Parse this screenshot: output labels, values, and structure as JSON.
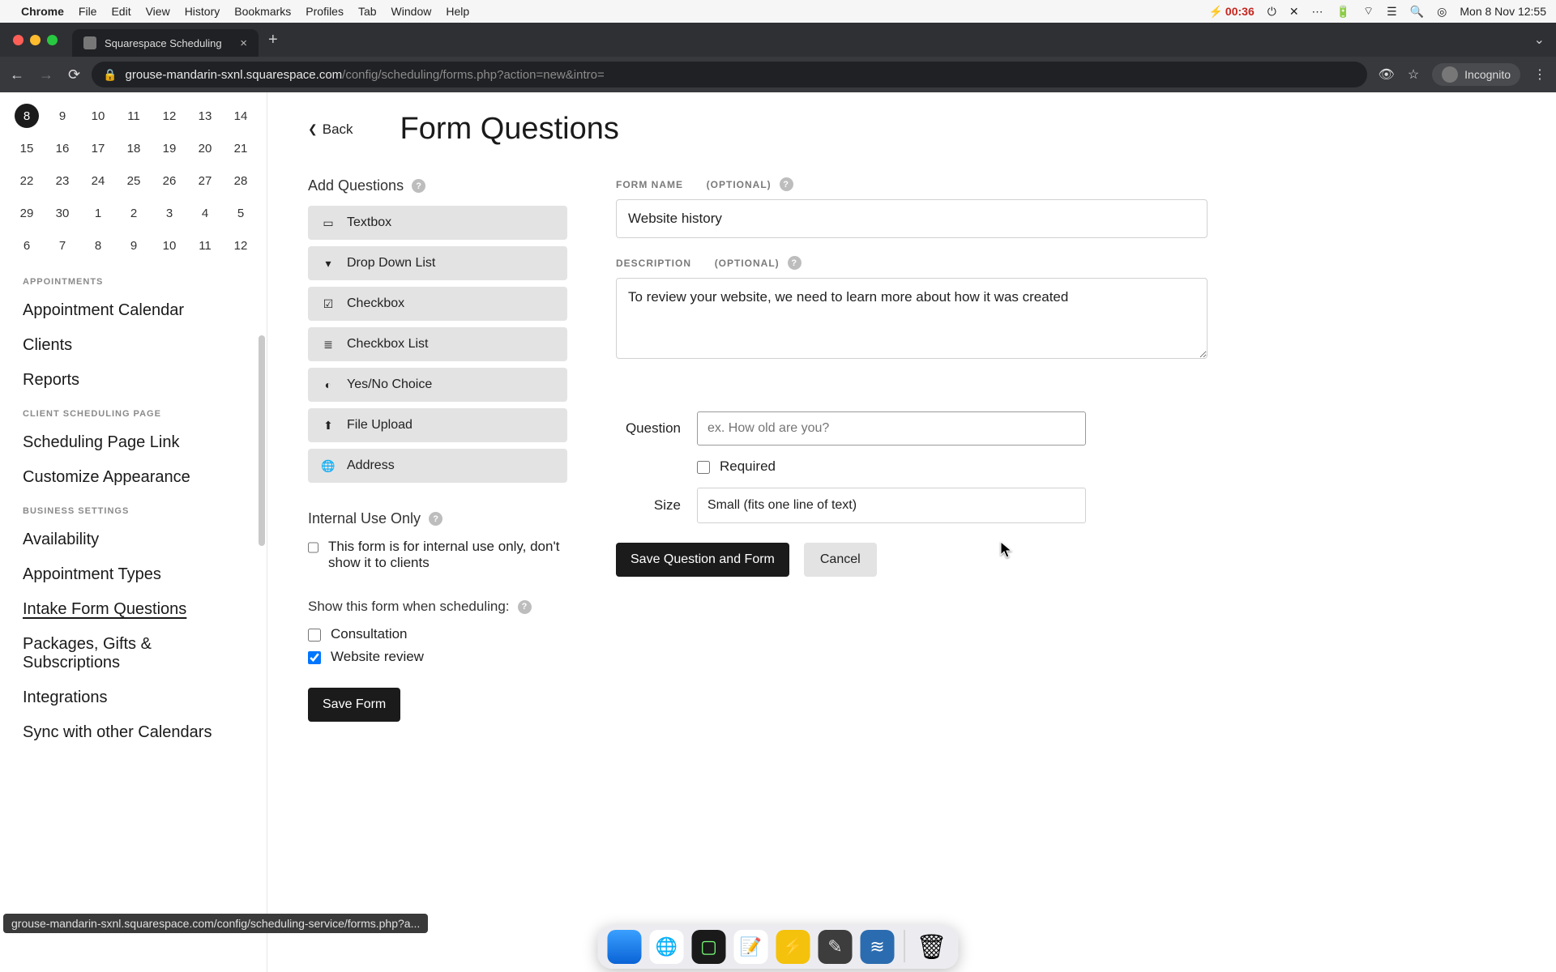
{
  "menubar": {
    "app": "Chrome",
    "items": [
      "File",
      "Edit",
      "View",
      "History",
      "Bookmarks",
      "Profiles",
      "Tab",
      "Window",
      "Help"
    ],
    "battery_time": "00:36",
    "clock": "Mon 8 Nov  12:55"
  },
  "browser": {
    "tab_title": "Squarespace Scheduling",
    "url_host": "grouse-mandarin-sxnl.squarespace.com",
    "url_path": "/config/scheduling/forms.php?action=new&intro=",
    "incognito_label": "Incognito",
    "hover_url": "grouse-mandarin-sxnl.squarespace.com/config/scheduling-service/forms.php?a..."
  },
  "sidebar": {
    "calendar": {
      "rows": [
        [
          "8",
          "9",
          "10",
          "11",
          "12",
          "13",
          "14"
        ],
        [
          "15",
          "16",
          "17",
          "18",
          "19",
          "20",
          "21"
        ],
        [
          "22",
          "23",
          "24",
          "25",
          "26",
          "27",
          "28"
        ],
        [
          "29",
          "30",
          "1",
          "2",
          "3",
          "4",
          "5"
        ],
        [
          "6",
          "7",
          "8",
          "9",
          "10",
          "11",
          "12"
        ]
      ],
      "selected": "8"
    },
    "sections": [
      {
        "title": "APPOINTMENTS",
        "items": [
          "Appointment Calendar",
          "Clients",
          "Reports"
        ]
      },
      {
        "title": "CLIENT SCHEDULING PAGE",
        "items": [
          "Scheduling Page Link",
          "Customize Appearance"
        ]
      },
      {
        "title": "BUSINESS SETTINGS",
        "items": [
          "Availability",
          "Appointment Types",
          "Intake Form Questions",
          "Packages, Gifts & Subscriptions",
          "Integrations",
          "Sync with other Calendars"
        ]
      }
    ],
    "active_item": "Intake Form Questions"
  },
  "page": {
    "back_label": "Back",
    "title": "Form Questions",
    "add_questions_label": "Add Questions",
    "question_types": [
      "Textbox",
      "Drop Down List",
      "Checkbox",
      "Checkbox List",
      "Yes/No Choice",
      "File Upload",
      "Address"
    ],
    "internal_label": "Internal Use Only",
    "internal_checkbox": "This form is for internal use only, don't show it to clients",
    "show_when_label": "Show this form when scheduling:",
    "schedule_options": [
      {
        "label": "Consultation",
        "checked": false
      },
      {
        "label": "Website review",
        "checked": true
      }
    ],
    "save_form": "Save Form",
    "form_name_label": "FORM NAME",
    "optional": "(OPTIONAL)",
    "form_name_value": "Website history",
    "description_label": "DESCRIPTION",
    "description_value": "To review your website, we need to learn more about how it was created",
    "question_row_label": "Question",
    "question_placeholder": "ex. How old are you?",
    "required_label": "Required",
    "size_row_label": "Size",
    "size_value": "Small (fits one line of text)",
    "save_question_btn": "Save Question and Form",
    "cancel_btn": "Cancel"
  },
  "qtype_icons": {
    "Textbox": "▭",
    "Drop Down List": "▾",
    "Checkbox": "☑",
    "Checkbox List": "≣",
    "Yes/No Choice": "◐",
    "File Upload": "⬆",
    "Address": "🌐"
  }
}
